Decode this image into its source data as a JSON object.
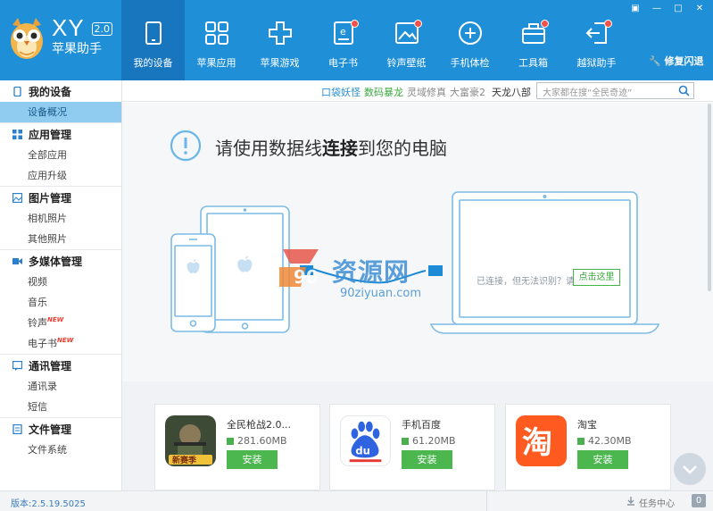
{
  "app": {
    "brand": "XY",
    "version_badge": "2.0",
    "brand_cn": "苹果助手"
  },
  "window_controls": [
    "▣",
    "—",
    "□",
    "✕"
  ],
  "nav": [
    {
      "label": "我的设备",
      "icon": "device-icon",
      "active": true,
      "dot": false
    },
    {
      "label": "苹果应用",
      "icon": "apps-grid-icon",
      "active": false,
      "dot": false
    },
    {
      "label": "苹果游戏",
      "icon": "gamepad-icon",
      "active": false,
      "dot": false
    },
    {
      "label": "电子书",
      "icon": "ebook-icon",
      "active": false,
      "dot": true
    },
    {
      "label": "铃声壁纸",
      "icon": "wallpaper-icon",
      "active": false,
      "dot": true
    },
    {
      "label": "手机体检",
      "icon": "checkup-icon",
      "active": false,
      "dot": false
    },
    {
      "label": "工具箱",
      "icon": "toolbox-icon",
      "active": false,
      "dot": true
    },
    {
      "label": "越狱助手",
      "icon": "jailbreak-icon",
      "active": false,
      "dot": true
    }
  ],
  "repair_label": "修复闪退",
  "sidebar": {
    "sections": [
      {
        "title": "我的设备",
        "icon": "phone-icon",
        "items": [
          {
            "label": "设备概况",
            "active": true,
            "new": false
          }
        ]
      },
      {
        "title": "应用管理",
        "icon": "apps-icon",
        "items": [
          {
            "label": "全部应用",
            "new": false
          },
          {
            "label": "应用升级",
            "new": false
          }
        ]
      },
      {
        "title": "图片管理",
        "icon": "image-icon",
        "items": [
          {
            "label": "相机照片",
            "new": false
          },
          {
            "label": "其他照片",
            "new": false
          }
        ]
      },
      {
        "title": "多媒体管理",
        "icon": "media-icon",
        "items": [
          {
            "label": "视频",
            "new": false
          },
          {
            "label": "音乐",
            "new": false
          },
          {
            "label": "铃声",
            "new": true
          },
          {
            "label": "电子书",
            "new": true
          }
        ]
      },
      {
        "title": "通讯管理",
        "icon": "chat-icon",
        "items": [
          {
            "label": "通讯录",
            "new": false
          },
          {
            "label": "短信",
            "new": false
          }
        ]
      },
      {
        "title": "文件管理",
        "icon": "file-icon",
        "items": [
          {
            "label": "文件系统",
            "new": false
          }
        ]
      }
    ],
    "new_badge": "NEW"
  },
  "quick_links": [
    {
      "label": "口袋妖怪",
      "color": "#2a8fd4"
    },
    {
      "label": "数码暴龙",
      "color": "#3aa83d"
    },
    {
      "label": "灵域修真",
      "color": "#888888"
    },
    {
      "label": "大富豪2",
      "color": "#888888"
    },
    {
      "label": "天龙八部",
      "color": "#333333"
    }
  ],
  "search": {
    "placeholder": "大家都在搜“全民奇迹”"
  },
  "hero": {
    "title_before": "请使用数据线",
    "title_bold": "连接",
    "title_after": "到您的电脑",
    "connect_text": "已连接，但无法识别？请",
    "click_here": "点击这里"
  },
  "watermark": {
    "main": "资源网",
    "sub": "90ziyuan.com"
  },
  "apps": [
    {
      "name": "全民枪战2.0...",
      "size": "281.60MB",
      "install": "安装",
      "icon": "game-shooter-icon"
    },
    {
      "name": "手机百度",
      "size": "61.20MB",
      "install": "安装",
      "icon": "baidu-icon"
    },
    {
      "name": "淘宝",
      "size": "42.30MB",
      "install": "安装",
      "icon": "taobao-icon"
    }
  ],
  "status": {
    "version": "版本:2.5.19.5025",
    "task_center": "任务中心",
    "task_count": "0"
  },
  "colors": {
    "topbar": "#1f8fd7",
    "topbar_active": "#1876bf",
    "sidebar_active": "#8fccf0",
    "install_green": "#4cb64f",
    "badge_red": "#f0524a"
  }
}
